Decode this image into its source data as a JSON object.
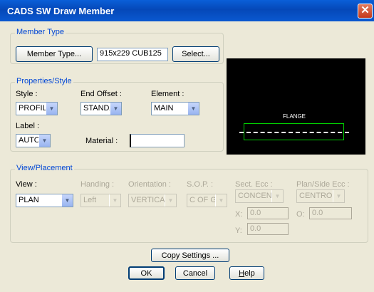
{
  "window": {
    "title": "CADS SW Draw Member"
  },
  "member_type": {
    "legend": "Member Type",
    "button_label": "Member Type...",
    "value": "915x229 CUB125",
    "select_label": "Select..."
  },
  "properties": {
    "legend": "Properties/Style",
    "style_label": "Style :",
    "style_value": "PROFILE",
    "end_offset_label": "End Offset :",
    "end_offset_value": "STANDARD",
    "element_label": "Element :",
    "element_value": "MAIN",
    "label_label": "Label :",
    "label_value": "AUTO",
    "material_label": "Material :",
    "material_value": ""
  },
  "preview": {
    "flange_label": "FLANGE",
    "box_color": "#00d000",
    "line_color": "#ffffff"
  },
  "view_placement": {
    "legend": "View/Placement",
    "view_label": "View :",
    "view_value": "PLAN",
    "handing_label": "Handing :",
    "handing_value": "Left",
    "orientation_label": "Orientation :",
    "orientation_value": "VERTICAL",
    "sop_label": "S.O.P. :",
    "sop_value": "C OF G",
    "sect_ecc_label": "Sect. Ecc :",
    "sect_ecc_value": "CONCENTRIC",
    "plan_side_label": "Plan/Side Ecc :",
    "plan_side_value": "CENTROID",
    "x_label": "X:",
    "x_value": "0.0",
    "y_label": "Y:",
    "y_value": "0.0",
    "o_label": "O:",
    "o_value": "0.0"
  },
  "buttons": {
    "copy_settings": "Copy Settings ...",
    "ok": "OK",
    "cancel": "Cancel",
    "help_h": "H",
    "help_rest": "elp"
  }
}
